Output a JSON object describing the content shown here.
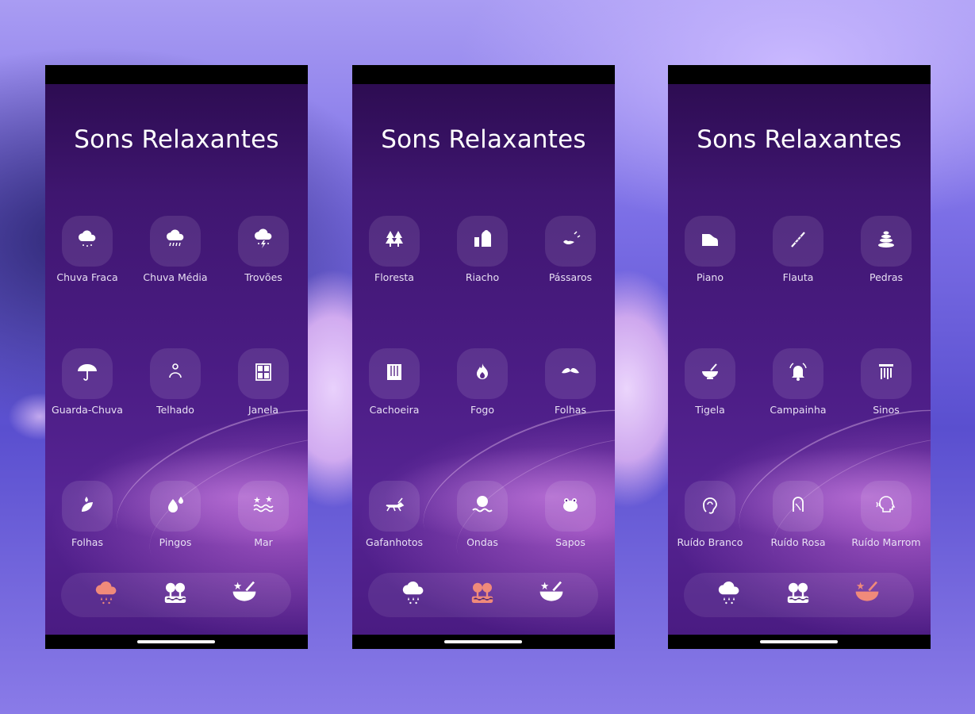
{
  "colors": {
    "icon": "#ffffff",
    "active_nav": "#f08a7a",
    "label": "#e8e0f4",
    "screen_top": "#2d0c52",
    "screen_bottom": "#562493"
  },
  "screens": [
    {
      "title": "Sons Relaxantes",
      "tiles": [
        {
          "label": "Chuva Fraca",
          "icon": "cloud-rain-light-icon"
        },
        {
          "label": "Chuva Média",
          "icon": "cloud-rain-heavy-icon"
        },
        {
          "label": "Trovões",
          "icon": "thunderstorm-icon"
        },
        {
          "label": "Guarda-Chuva",
          "icon": "umbrella-icon"
        },
        {
          "label": "Telhado",
          "icon": "roof-icon"
        },
        {
          "label": "Janela",
          "icon": "window-icon"
        },
        {
          "label": "Folhas",
          "icon": "leaves-drops-icon"
        },
        {
          "label": "Pingos",
          "icon": "droplets-icon"
        },
        {
          "label": "Mar",
          "icon": "sea-waves-icon"
        }
      ],
      "nav": [
        {
          "icon": "rain-category-icon",
          "active": true
        },
        {
          "icon": "nature-category-icon",
          "active": false
        },
        {
          "icon": "meditation-category-icon",
          "active": false
        }
      ]
    },
    {
      "title": "Sons Relaxantes",
      "tiles": [
        {
          "label": "Floresta",
          "icon": "forest-icon"
        },
        {
          "label": "Riacho",
          "icon": "stream-icon"
        },
        {
          "label": "Pássaros",
          "icon": "birds-icon"
        },
        {
          "label": "Cachoeira",
          "icon": "waterfall-icon"
        },
        {
          "label": "Fogo",
          "icon": "fire-icon"
        },
        {
          "label": "Folhas",
          "icon": "leaf-icon"
        },
        {
          "label": "Gafanhotos",
          "icon": "grasshopper-icon"
        },
        {
          "label": "Ondas",
          "icon": "waves-icon"
        },
        {
          "label": "Sapos",
          "icon": "frog-icon"
        }
      ],
      "nav": [
        {
          "icon": "rain-category-icon",
          "active": false
        },
        {
          "icon": "nature-category-icon",
          "active": true
        },
        {
          "icon": "meditation-category-icon",
          "active": false
        }
      ]
    },
    {
      "title": "Sons Relaxantes",
      "tiles": [
        {
          "label": "Piano",
          "icon": "piano-icon"
        },
        {
          "label": "Flauta",
          "icon": "flute-icon"
        },
        {
          "label": "Pedras",
          "icon": "stones-icon"
        },
        {
          "label": "Tigela",
          "icon": "singing-bowl-icon"
        },
        {
          "label": "Campainha",
          "icon": "bell-icon"
        },
        {
          "label": "Sinos",
          "icon": "wind-chimes-icon"
        },
        {
          "label": "Ruído Branco",
          "icon": "ear-white-noise-icon"
        },
        {
          "label": "Ruído Rosa",
          "icon": "ear-pink-noise-icon"
        },
        {
          "label": "Ruído Marrom",
          "icon": "head-brown-noise-icon"
        }
      ],
      "nav": [
        {
          "icon": "rain-category-icon",
          "active": false
        },
        {
          "icon": "nature-category-icon",
          "active": false
        },
        {
          "icon": "meditation-category-icon",
          "active": true
        }
      ]
    }
  ]
}
